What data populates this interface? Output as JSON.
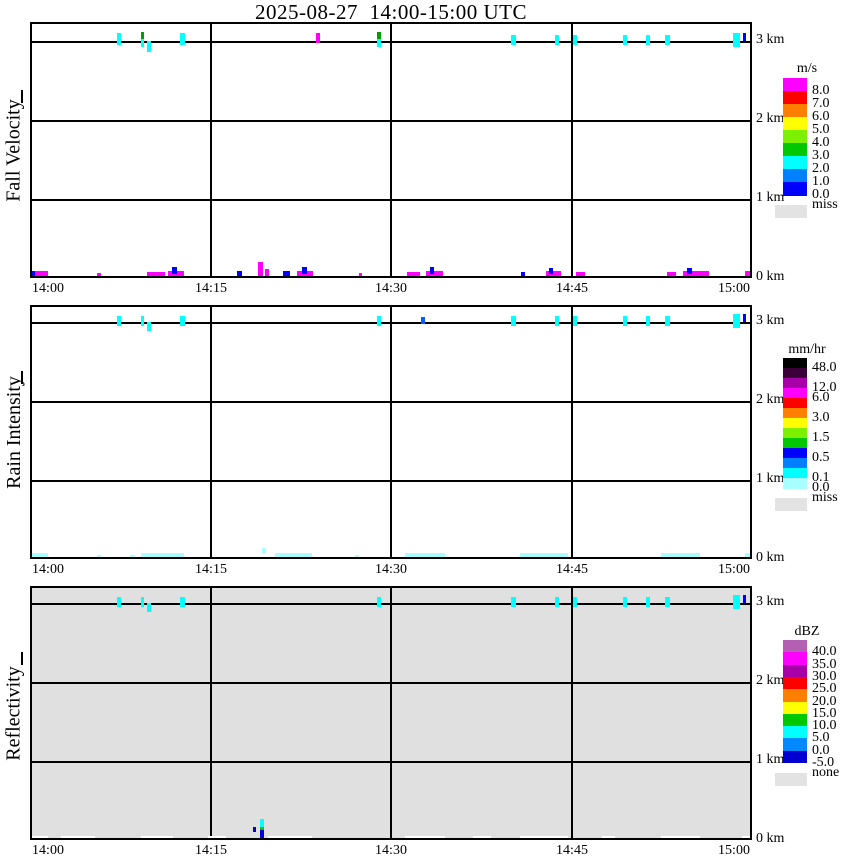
{
  "title": "2025-08-27  14:00-15:00 UTC",
  "chart_data": {
    "type": "heatmap",
    "title": "2025-08-27  14:00-15:00 UTC",
    "x_axis": {
      "ticks": [
        "14:00",
        "14:15",
        "14:30",
        "14:45",
        "15:00"
      ],
      "range_minutes": [
        0,
        60
      ],
      "units": "UTC"
    },
    "y_axis": {
      "ticks": [
        "3 km",
        "2 km",
        "1 km",
        "0 km"
      ],
      "range_km": [
        0,
        3.24
      ],
      "grid_km": [
        1,
        2,
        3
      ]
    },
    "grid_minutes": [
      15,
      30,
      45
    ],
    "panels": [
      {
        "name": "Fall Velocity",
        "units": "m/s",
        "background": "#FFFFFF",
        "marks": [
          [
            7.2,
            7.55,
            2.95,
            3.1,
            "#00FFFF"
          ],
          [
            9.2,
            9.5,
            3.02,
            3.12,
            "#00A000"
          ],
          [
            9.2,
            9.5,
            2.92,
            3.02,
            "#00FFFF"
          ],
          [
            9.75,
            10.05,
            2.86,
            3.0,
            "#00FFFF"
          ],
          [
            12.5,
            12.85,
            2.95,
            3.1,
            "#00FFFF"
          ],
          [
            23.8,
            24.1,
            2.97,
            3.1,
            "#FF00FF"
          ],
          [
            28.8,
            29.15,
            3.03,
            3.12,
            "#00A000"
          ],
          [
            28.8,
            29.15,
            2.93,
            3.03,
            "#00FFFF"
          ],
          [
            40.0,
            40.35,
            2.95,
            3.08,
            "#00FFFF"
          ],
          [
            43.6,
            43.95,
            2.95,
            3.08,
            "#00FFFF"
          ],
          [
            45.1,
            45.45,
            2.95,
            3.08,
            "#00FFFF"
          ],
          [
            49.3,
            49.65,
            2.95,
            3.08,
            "#00FFFF"
          ],
          [
            51.2,
            51.55,
            2.95,
            3.08,
            "#00FFFF"
          ],
          [
            52.8,
            53.15,
            2.95,
            3.08,
            "#00FFFF"
          ],
          [
            58.4,
            59.0,
            2.92,
            3.1,
            "#00FFFF"
          ],
          [
            59.25,
            59.5,
            3.0,
            3.1,
            "#0000FF"
          ],
          [
            0.0,
            0.45,
            0,
            0.09,
            "#0000FF"
          ],
          [
            0.45,
            1.5,
            0,
            0.09,
            "#FF00FF"
          ],
          [
            5.6,
            5.9,
            0,
            0.06,
            "#FF00FF"
          ],
          [
            9.7,
            11.2,
            0,
            0.08,
            "#FF00FF"
          ],
          [
            11.5,
            12.8,
            0,
            0.09,
            "#FF00FF"
          ],
          [
            11.8,
            12.25,
            0.05,
            0.14,
            "#0000FF"
          ],
          [
            17.2,
            17.6,
            0,
            0.09,
            "#0000FF"
          ],
          [
            18.95,
            19.4,
            0,
            0.2,
            "#FF00FF"
          ],
          [
            19.5,
            19.9,
            0,
            0.12,
            "#FF00FF"
          ],
          [
            21.0,
            21.6,
            0,
            0.09,
            "#0000FF"
          ],
          [
            22.2,
            23.5,
            0,
            0.09,
            "#FF00FF"
          ],
          [
            22.6,
            23.0,
            0.05,
            0.14,
            "#0000FF"
          ],
          [
            27.3,
            27.6,
            0,
            0.06,
            "#FF00FF"
          ],
          [
            31.3,
            32.4,
            0,
            0.08,
            "#FF00FF"
          ],
          [
            32.9,
            34.3,
            0,
            0.09,
            "#FF00FF"
          ],
          [
            33.2,
            33.6,
            0.05,
            0.14,
            "#0000FF"
          ],
          [
            40.8,
            41.1,
            0,
            0.07,
            "#0000FF"
          ],
          [
            42.9,
            44.1,
            0,
            0.09,
            "#FF00FF"
          ],
          [
            43.1,
            43.5,
            0.05,
            0.13,
            "#0000FF"
          ],
          [
            45.4,
            46.1,
            0,
            0.07,
            "#FF00FF"
          ],
          [
            52.9,
            53.7,
            0,
            0.08,
            "#FF00FF"
          ],
          [
            54.3,
            56.4,
            0,
            0.09,
            "#FF00FF"
          ],
          [
            54.6,
            55.0,
            0.05,
            0.13,
            "#0000FF"
          ],
          [
            59.4,
            59.9,
            0,
            0.09,
            "#FF00FF"
          ]
        ]
      },
      {
        "name": "Rain Intensity",
        "units": "mm/hr",
        "background": "#FFFFFF",
        "marks": [
          [
            7.2,
            7.55,
            2.95,
            3.08,
            "#00FFFF"
          ],
          [
            9.2,
            9.5,
            2.95,
            3.08,
            "#00FFFF"
          ],
          [
            9.75,
            10.05,
            2.88,
            3.0,
            "#00FFFF"
          ],
          [
            12.5,
            12.85,
            2.95,
            3.08,
            "#00FFFF"
          ],
          [
            28.8,
            29.15,
            2.95,
            3.08,
            "#00FFFF"
          ],
          [
            32.5,
            32.8,
            2.97,
            3.06,
            "#0060FF"
          ],
          [
            40.0,
            40.35,
            2.95,
            3.08,
            "#00FFFF"
          ],
          [
            43.6,
            43.95,
            2.95,
            3.08,
            "#00FFFF"
          ],
          [
            45.1,
            45.45,
            2.95,
            3.08,
            "#00FFFF"
          ],
          [
            49.3,
            49.65,
            2.95,
            3.08,
            "#00FFFF"
          ],
          [
            51.2,
            51.55,
            2.95,
            3.08,
            "#00FFFF"
          ],
          [
            52.8,
            53.15,
            2.95,
            3.08,
            "#00FFFF"
          ],
          [
            58.4,
            59.0,
            2.92,
            3.1,
            "#00FFFF"
          ],
          [
            59.25,
            59.5,
            3.0,
            3.1,
            "#0000FF"
          ],
          [
            0.0,
            1.5,
            0,
            0.07,
            "#A8FFFF"
          ],
          [
            5.6,
            5.9,
            0,
            0.05,
            "#A8FFFF"
          ],
          [
            8.3,
            8.7,
            0,
            0.05,
            "#A8FFFF"
          ],
          [
            9.2,
            12.8,
            0,
            0.07,
            "#A8FFFF"
          ],
          [
            19.3,
            19.6,
            0.08,
            0.14,
            "#A8FFFF"
          ],
          [
            20.4,
            23.4,
            0,
            0.07,
            "#A8FFFF"
          ],
          [
            27.0,
            27.35,
            0,
            0.05,
            "#A8FFFF"
          ],
          [
            31.2,
            34.5,
            0,
            0.07,
            "#A8FFFF"
          ],
          [
            40.7,
            44.7,
            0,
            0.07,
            "#A8FFFF"
          ],
          [
            52.4,
            55.7,
            0,
            0.07,
            "#A8FFFF"
          ],
          [
            59.4,
            60.0,
            0,
            0.07,
            "#A8FFFF"
          ]
        ]
      },
      {
        "name": "Reflectivity",
        "units": "dBZ",
        "background": "#E0E0E0",
        "marks": [
          [
            7.2,
            7.55,
            2.95,
            3.08,
            "#00FFFF"
          ],
          [
            9.2,
            9.5,
            2.95,
            3.08,
            "#00FFFF"
          ],
          [
            9.75,
            10.05,
            2.88,
            3.0,
            "#00FFFF"
          ],
          [
            12.5,
            12.85,
            2.95,
            3.08,
            "#00FFFF"
          ],
          [
            28.8,
            29.15,
            2.95,
            3.08,
            "#00FFFF"
          ],
          [
            40.0,
            40.35,
            2.95,
            3.08,
            "#00FFFF"
          ],
          [
            43.6,
            43.95,
            2.95,
            3.08,
            "#00FFFF"
          ],
          [
            45.1,
            45.45,
            2.95,
            3.08,
            "#00FFFF"
          ],
          [
            49.3,
            49.65,
            2.95,
            3.08,
            "#00FFFF"
          ],
          [
            51.2,
            51.55,
            2.95,
            3.08,
            "#00FFFF"
          ],
          [
            52.8,
            53.15,
            2.95,
            3.08,
            "#00FFFF"
          ],
          [
            58.4,
            59.0,
            2.92,
            3.1,
            "#00FFFF"
          ],
          [
            59.25,
            59.5,
            3.0,
            3.1,
            "#0000FF"
          ],
          [
            0.0,
            1.5,
            0,
            0.05,
            "#FFFFFF"
          ],
          [
            2.6,
            5.4,
            0,
            0.05,
            "#FFFFFF"
          ],
          [
            9.2,
            11.9,
            0,
            0.05,
            "#FFFFFF"
          ],
          [
            14.8,
            16.3,
            0,
            0.05,
            "#FFFFFF"
          ],
          [
            19.8,
            23.4,
            0,
            0.05,
            "#FFFFFF"
          ],
          [
            31.2,
            34.5,
            0,
            0.05,
            "#FFFFFF"
          ],
          [
            36.8,
            38.3,
            0,
            0.05,
            "#FFFFFF"
          ],
          [
            40.7,
            44.7,
            0,
            0.05,
            "#FFFFFF"
          ],
          [
            47.5,
            48.6,
            0,
            0.05,
            "#FFFFFF"
          ],
          [
            52.4,
            55.7,
            0,
            0.05,
            "#FFFFFF"
          ],
          [
            59.2,
            60.0,
            0,
            0.05,
            "#FFFFFF"
          ],
          [
            18.5,
            18.8,
            0.1,
            0.16,
            "#0000E0"
          ],
          [
            19.1,
            19.45,
            0.17,
            0.26,
            "#00FFFF"
          ],
          [
            19.1,
            19.45,
            0.13,
            0.17,
            "#00C800"
          ],
          [
            19.1,
            19.45,
            0.02,
            0.13,
            "#0000E0"
          ]
        ]
      }
    ],
    "colorbars": [
      {
        "units": "m/s",
        "miss_label": "miss",
        "miss_color": "#E3E3E3",
        "entries": [
          [
            "8.0",
            "#FF00FF"
          ],
          [
            "7.0",
            "#FF0000"
          ],
          [
            "6.0",
            "#FF8000"
          ],
          [
            "5.0",
            "#FFFF00"
          ],
          [
            "4.0",
            "#7DF000"
          ],
          [
            "3.0",
            "#00C800"
          ],
          [
            "2.0",
            "#00FFFF"
          ],
          [
            "1.0",
            "#0080FF"
          ],
          [
            "0.0",
            "#0000FF"
          ]
        ]
      },
      {
        "units": "mm/hr",
        "miss_label": "miss",
        "miss_color": "#E3E3E3",
        "entries": [
          [
            "48.0",
            "#000000"
          ],
          [
            "",
            "#3C0038"
          ],
          [
            "12.0",
            "#A800A8"
          ],
          [
            "6.0",
            "#FF00FF"
          ],
          [
            "",
            "#FF0000"
          ],
          [
            "3.0",
            "#FF8000"
          ],
          [
            "",
            "#FFFF00"
          ],
          [
            "1.5",
            "#7DF000"
          ],
          [
            "",
            "#00C800"
          ],
          [
            "0.5",
            "#0000FF"
          ],
          [
            "",
            "#0080FF"
          ],
          [
            "0.1",
            "#00FFFF"
          ],
          [
            "0.0",
            "#A8FFFF"
          ]
        ]
      },
      {
        "units": "dBZ",
        "miss_label": "none",
        "miss_color": "#E3E3E3",
        "entries": [
          [
            "40.0",
            "#B45FB4"
          ],
          [
            "35.0",
            "#FF00FF"
          ],
          [
            "30.0",
            "#A800A8"
          ],
          [
            "25.0",
            "#FF0000"
          ],
          [
            "20.0",
            "#FF8000"
          ],
          [
            "15.0",
            "#FFFF00"
          ],
          [
            "10.0",
            "#00C800"
          ],
          [
            "5.0",
            "#00FFFF"
          ],
          [
            "0.0",
            "#0088FF"
          ],
          [
            "-5.0",
            "#0000D0"
          ]
        ]
      }
    ]
  }
}
